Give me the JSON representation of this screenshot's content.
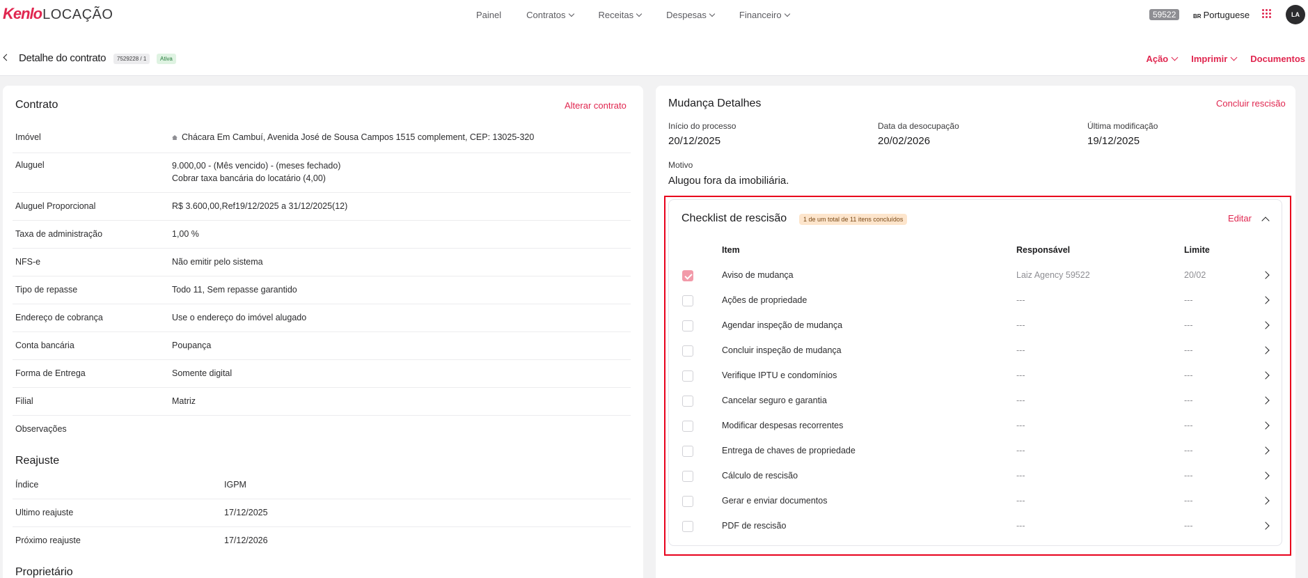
{
  "brand": {
    "logo_main": "Kenlo",
    "logo_sub": "LOCAÇÃO"
  },
  "nav": {
    "items": [
      {
        "label": "Painel",
        "dropdown": false
      },
      {
        "label": "Contratos",
        "dropdown": true
      },
      {
        "label": "Receitas",
        "dropdown": true
      },
      {
        "label": "Despesas",
        "dropdown": true
      },
      {
        "label": "Financeiro",
        "dropdown": true
      }
    ]
  },
  "user": {
    "agency_code": "59522",
    "language_flag": "BR",
    "language": "Portuguese",
    "avatar_initials": "LA"
  },
  "header": {
    "title": "Detalhe do contrato",
    "contract_id": "7529228 / 1",
    "status": "Ativa",
    "actions": [
      {
        "label": "Ação",
        "dropdown": true
      },
      {
        "label": "Imprimir",
        "dropdown": true
      },
      {
        "label": "Documentos",
        "dropdown": false
      }
    ]
  },
  "contract": {
    "title": "Contrato",
    "edit_label": "Alterar contrato",
    "rows": [
      {
        "label": "Imóvel",
        "value": "Chácara Em Cambuí, Avenida José de Sousa Campos 1515 complement, CEP: 13025-320",
        "value2": ""
      },
      {
        "label": "Aluguel",
        "value": "9.000,00 - (Mês vencido) - (meses fechado)",
        "value2": "Cobrar taxa bancária do locatário (4,00)"
      },
      {
        "label": "Aluguel Proporcional",
        "value": "R$ 3.600,00,Ref19/12/2025 a 31/12/2025(12)",
        "value2": ""
      },
      {
        "label": "Taxa de administração",
        "value": "1,00 %",
        "value2": ""
      },
      {
        "label": "NFS-e",
        "value": "Não emitir pelo sistema",
        "value2": ""
      },
      {
        "label": "Tipo de repasse",
        "value": "Todo 11, Sem repasse garantido",
        "value2": ""
      },
      {
        "label": "Endereço de cobrança",
        "value": "Use o endereço do imóvel alugado",
        "value2": ""
      },
      {
        "label": "Conta bancária",
        "value": "Poupança",
        "value2": ""
      },
      {
        "label": "Forma de Entrega",
        "value": "Somente digital",
        "value2": ""
      },
      {
        "label": "Filial",
        "value": "Matriz",
        "value2": ""
      },
      {
        "label": "Observações",
        "value": "",
        "value2": ""
      }
    ]
  },
  "reajuste": {
    "title": "Reajuste",
    "rows": [
      {
        "label": "Índice",
        "value": "IGPM"
      },
      {
        "label": "Ultimo reajuste",
        "value": "17/12/2025"
      },
      {
        "label": "Próximo reajuste",
        "value": "17/12/2026"
      }
    ]
  },
  "proprietario": {
    "title": "Proprietário"
  },
  "mudanca": {
    "title": "Mudança Detalhes",
    "conclude_label": "Concluir rescisão",
    "fields": [
      {
        "label": "Início do processo",
        "value": "20/12/2025"
      },
      {
        "label": "Data da desocupação",
        "value": "20/02/2026"
      },
      {
        "label": "Última modificação",
        "value": "19/12/2025"
      }
    ],
    "motivo_label": "Motivo",
    "motivo_value": "Alugou fora da imobiliária."
  },
  "checklist": {
    "title": "Checklist de rescisão",
    "progress": "1 de um total de 11 itens concluídos",
    "edit_label": "Editar",
    "headers": {
      "item": "Item",
      "responsavel": "Responsável",
      "limite": "Limite"
    },
    "items": [
      {
        "label": "Aviso de mudança",
        "responsavel": "Laiz Agency 59522",
        "limite": "20/02",
        "checked": true
      },
      {
        "label": "Ações de propriedade",
        "responsavel": "---",
        "limite": "---",
        "checked": false
      },
      {
        "label": "Agendar inspeção de mudança",
        "responsavel": "---",
        "limite": "---",
        "checked": false
      },
      {
        "label": "Concluir inspeção de mudança",
        "responsavel": "---",
        "limite": "---",
        "checked": false
      },
      {
        "label": "Verifique IPTU e condomínios",
        "responsavel": "---",
        "limite": "---",
        "checked": false
      },
      {
        "label": "Cancelar seguro e garantia",
        "responsavel": "---",
        "limite": "---",
        "checked": false
      },
      {
        "label": "Modificar despesas recorrentes",
        "responsavel": "---",
        "limite": "---",
        "checked": false
      },
      {
        "label": "Entrega de chaves de propriedade",
        "responsavel": "---",
        "limite": "---",
        "checked": false
      },
      {
        "label": "Cálculo de rescisão",
        "responsavel": "---",
        "limite": "---",
        "checked": false
      },
      {
        "label": "Gerar e enviar documentos",
        "responsavel": "---",
        "limite": "---",
        "checked": false
      },
      {
        "label": "PDF de rescisão",
        "responsavel": "---",
        "limite": "---",
        "checked": false
      }
    ]
  },
  "colors": {
    "accent": "#e0264f",
    "highlight_border": "#e8001c",
    "status_green_bg": "#dff3e2",
    "progress_bg": "#fde5cc"
  },
  "icons": [
    "back-chevron-icon",
    "chevron-down-icon",
    "apps-grid-icon",
    "house-icon",
    "chevron-up-icon",
    "chevron-right-icon",
    "checkbox-icon"
  ]
}
